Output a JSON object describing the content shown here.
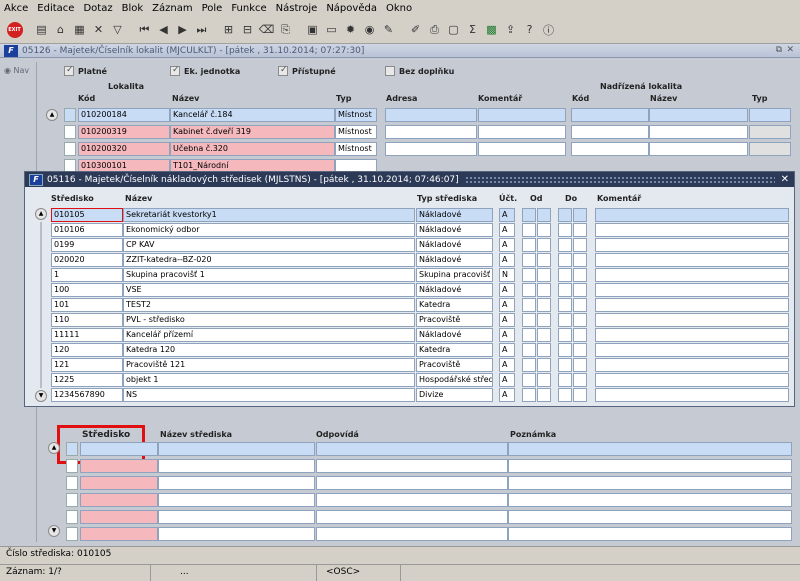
{
  "menu": [
    "Akce",
    "Editace",
    "Dotaz",
    "Blok",
    "Záznam",
    "Pole",
    "Funkce",
    "Nástroje",
    "Nápověda",
    "Okno"
  ],
  "toolbar": {
    "exit_label": "EXIT"
  },
  "main_window": {
    "title": "05126 - Majetek/Číselník lokalit (MJCULKLT) - [pátek  , 31.10.2014; 07:27:30]",
    "nav_label": "Nav",
    "filters": {
      "platne": "Platné",
      "ek_jednotka": "Ek. jednotka",
      "pristupne": "Přístupné",
      "bez_doplnku": "Bez doplňku"
    },
    "headers": {
      "lokalita": "Lokalita",
      "kod": "Kód",
      "nazev": "Název",
      "typ": "Typ",
      "adresa": "Adresa",
      "komentar": "Komentář",
      "nadrizena": "Nadřízená lokalita",
      "n_kod": "Kód",
      "n_nazev": "Název",
      "n_typ": "Typ"
    },
    "rows": [
      {
        "kod": "010200184",
        "nazev": "Kancelář č.184",
        "typ": "Místnost"
      },
      {
        "kod": "010200319",
        "nazev": "Kabinet č.dveří 319",
        "typ": "Místnost"
      },
      {
        "kod": "010200320",
        "nazev": "Učebna č.320",
        "typ": "Místnost"
      },
      {
        "kod": "010300101",
        "nazev": "T101_Národní",
        "typ": ""
      }
    ]
  },
  "dialog": {
    "title": "05116 - Majetek/Číselník nákladových středisek (MJLSTNS) - [pátek  , 31.10.2014; 07:46:07]",
    "headers": {
      "stredisko": "Středisko",
      "nazev": "Název",
      "typ": "Typ střediska",
      "uct": "Účt.",
      "od": "Od",
      "do": "Do",
      "komentar": "Komentář"
    },
    "rows": [
      {
        "stredisko": "010105",
        "nazev": "Sekretariát kvestorky1",
        "typ": "Nákladové",
        "uct": "A"
      },
      {
        "stredisko": "010106",
        "nazev": "Ekonomický odbor",
        "typ": "Nákladové",
        "uct": "A"
      },
      {
        "stredisko": "0199",
        "nazev": "CP KAV",
        "typ": "Nákladové",
        "uct": "A"
      },
      {
        "stredisko": "020020",
        "nazev": "ZZIT-katedra--BZ-020",
        "typ": "Nákladové",
        "uct": "A"
      },
      {
        "stredisko": "1",
        "nazev": "Skupina pracovišť 1",
        "typ": "Skupina pracovišť",
        "uct": "N"
      },
      {
        "stredisko": "100",
        "nazev": "VSE",
        "typ": "Nákladové",
        "uct": "A"
      },
      {
        "stredisko": "101",
        "nazev": "TEST2",
        "typ": "Katedra",
        "uct": "A"
      },
      {
        "stredisko": "110",
        "nazev": "PVL - středisko",
        "typ": "Pracoviště",
        "uct": "A"
      },
      {
        "stredisko": "11111",
        "nazev": "Kancelář přízemí",
        "typ": "Nákladové",
        "uct": "A"
      },
      {
        "stredisko": "120",
        "nazev": "Katedra 120",
        "typ": "Katedra",
        "uct": "A"
      },
      {
        "stredisko": "121",
        "nazev": "Pracoviště 121",
        "typ": "Pracoviště",
        "uct": "A"
      },
      {
        "stredisko": "1225",
        "nazev": "objekt 1",
        "typ": "Hospodářské středisko",
        "uct": "A"
      },
      {
        "stredisko": "1234567890",
        "nazev": "NS",
        "typ": "Divize",
        "uct": "A"
      }
    ]
  },
  "lower": {
    "headers": {
      "stredisko": "Středisko",
      "nazev": "Název střediska",
      "odpovida": "Odpovídá",
      "poznamka": "Poznámka"
    }
  },
  "status": {
    "line1": "Číslo střediska: 010105",
    "line2_left": "Záznam: 1/?",
    "line2_dots": "...",
    "line2_osc": "<OSC>"
  }
}
